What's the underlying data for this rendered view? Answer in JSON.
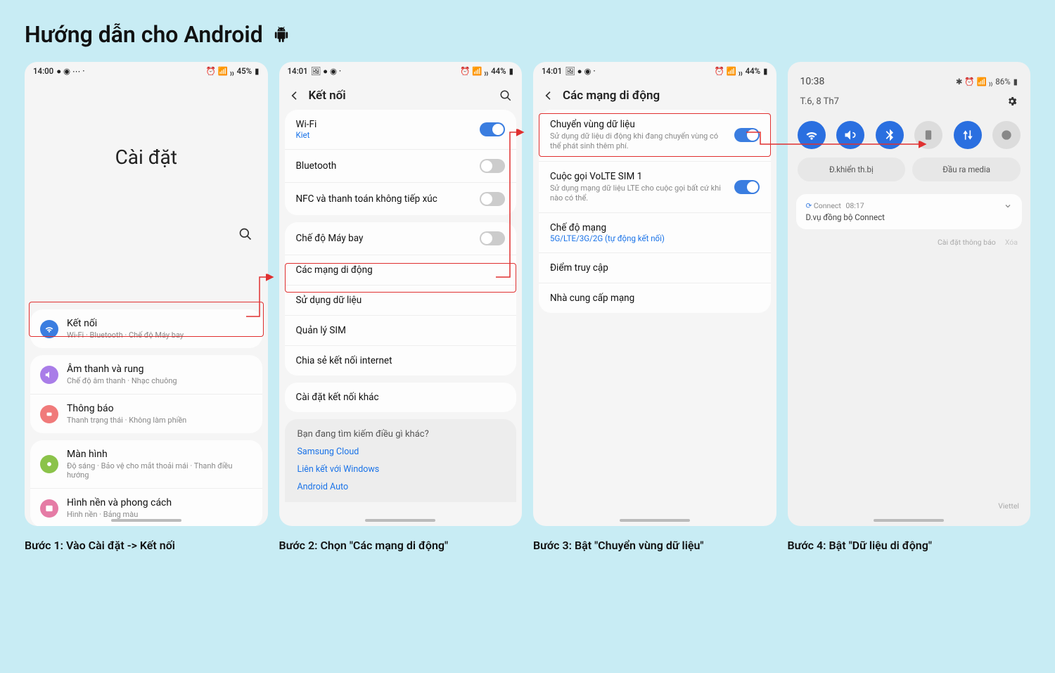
{
  "page": {
    "title": "Hướng dẫn cho Android"
  },
  "captions": {
    "s1": "Bước 1: Vào Cài đặt -> Kết nối",
    "s2": "Bước 2: Chọn \"Các mạng di động\"",
    "s3": "Bước 3: Bật \"Chuyển vùng dữ liệu\"",
    "s4": "Bước 4: Bật \"Dữ liệu di động\""
  },
  "statusbar": {
    "t1": "14:00",
    "t2": "14:01",
    "t3": "14:01",
    "b1": "45%",
    "b2": "44%",
    "b3": "44%"
  },
  "s1": {
    "title": "Cài đặt",
    "rows": {
      "connect": {
        "t": "Kết nối",
        "s": "Wi-Fi · Bluetooth · Chế độ Máy bay"
      },
      "sound": {
        "t": "Âm thanh và rung",
        "s": "Chế độ âm thanh · Nhạc chuông"
      },
      "notif": {
        "t": "Thông báo",
        "s": "Thanh trạng thái · Không làm phiền"
      },
      "display": {
        "t": "Màn hình",
        "s": "Độ sáng · Bảo vệ cho mắt thoải mái · Thanh điều hướng"
      },
      "wall": {
        "t": "Hình nền và phong cách",
        "s": "Hình nền · Bảng màu"
      }
    }
  },
  "s2": {
    "title": "Kết nối",
    "wifi": {
      "t": "Wi-Fi",
      "s": "Kiet"
    },
    "bt": "Bluetooth",
    "nfc": "NFC và thanh toán không tiếp xúc",
    "plane": "Chế độ Máy bay",
    "mob": "Các mạng di động",
    "data": "Sử dụng dữ liệu",
    "sim": "Quản lý SIM",
    "share": "Chia sẻ kết nối internet",
    "other": "Cài đặt kết nối khác",
    "extra_title": "Bạn đang tìm kiếm điều gì khác?",
    "extra1": "Samsung Cloud",
    "extra2": "Liên kết với Windows",
    "extra3": "Android Auto"
  },
  "s3": {
    "title": "Các mạng di động",
    "roam": {
      "t": "Chuyển vùng dữ liệu",
      "s": "Sử dụng dữ liệu di động khi đang chuyển vùng có thể phát sinh thêm phí."
    },
    "volte": {
      "t": "Cuộc gọi VoLTE SIM 1",
      "s": "Sử dụng mạng dữ liệu LTE cho cuộc gọi bất cứ khi nào có thể."
    },
    "mode": {
      "t": "Chế độ mạng",
      "s": "5G/LTE/3G/2G (tự động kết nối)"
    },
    "apn": "Điểm truy cập",
    "prov": "Nhà cung cấp mạng"
  },
  "s4": {
    "time": "10:38",
    "stat": "86%",
    "date": "T.6, 8 Th7",
    "ctrl1": "Đ.khiển th.bị",
    "ctrl2": "Đầu ra media",
    "notif_app": "Connect",
    "notif_time": "08:17",
    "notif_body": "D.vụ đồng bộ Connect",
    "notif_settings": "Cài đặt thông báo",
    "notif_clear": "Xóa",
    "carrier": "Viettel"
  }
}
